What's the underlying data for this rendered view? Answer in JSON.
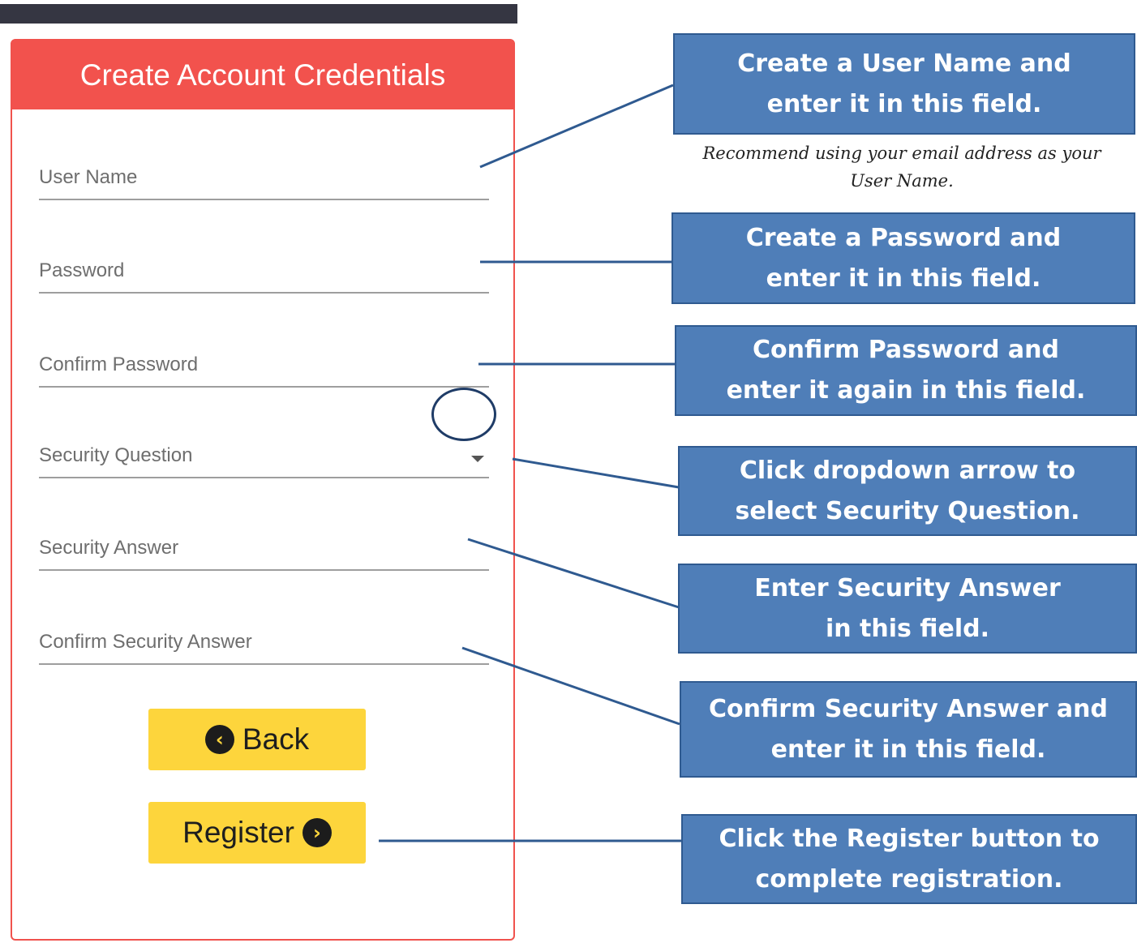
{
  "form": {
    "title": "Create Account Credentials",
    "fields": [
      {
        "label": "User Name"
      },
      {
        "label": "Password"
      },
      {
        "label": "Confirm Password"
      },
      {
        "label": "Security Question"
      },
      {
        "label": "Security Answer"
      },
      {
        "label": "Confirm Security Answer"
      }
    ],
    "back_label": "Back",
    "register_label": "Register"
  },
  "callouts": [
    {
      "line1": "Create a User Name and",
      "line2": "enter it in this field."
    },
    {
      "line1": "Create a Password and",
      "line2": "enter it in this field."
    },
    {
      "line1": "Confirm Password and",
      "line2": "enter it again in this field."
    },
    {
      "line1": "Click dropdown arrow to",
      "line2": "select Security Question."
    },
    {
      "line1": "Enter Security Answer",
      "line2": "in this field."
    },
    {
      "line1": "Confirm Security Answer and",
      "line2": "enter it in this field."
    },
    {
      "line1": "Click the Register button to",
      "line2": "complete registration."
    }
  ],
  "note": {
    "line1": "Recommend using your email address as your",
    "line2": "User Name."
  },
  "colors": {
    "header_red": "#f2524d",
    "button_yellow": "#fdd53c",
    "callout_blue": "#4f7eb8",
    "topbar_dark": "#353642"
  }
}
